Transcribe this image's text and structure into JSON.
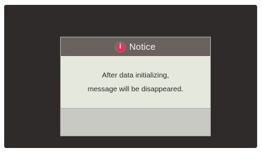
{
  "notice_dialog": {
    "title": "Notice",
    "icon": "info-icon",
    "icon_glyph": "i",
    "message_lines": [
      "After data initializing,",
      "message will be disappeared."
    ]
  },
  "colors": {
    "screen_background": "#2f2b2a",
    "dialog_header": "#6a625f",
    "dialog_body": "#e5e8dd",
    "dialog_footer": "#c7c9c2",
    "icon_accent": "#d63a5f"
  }
}
